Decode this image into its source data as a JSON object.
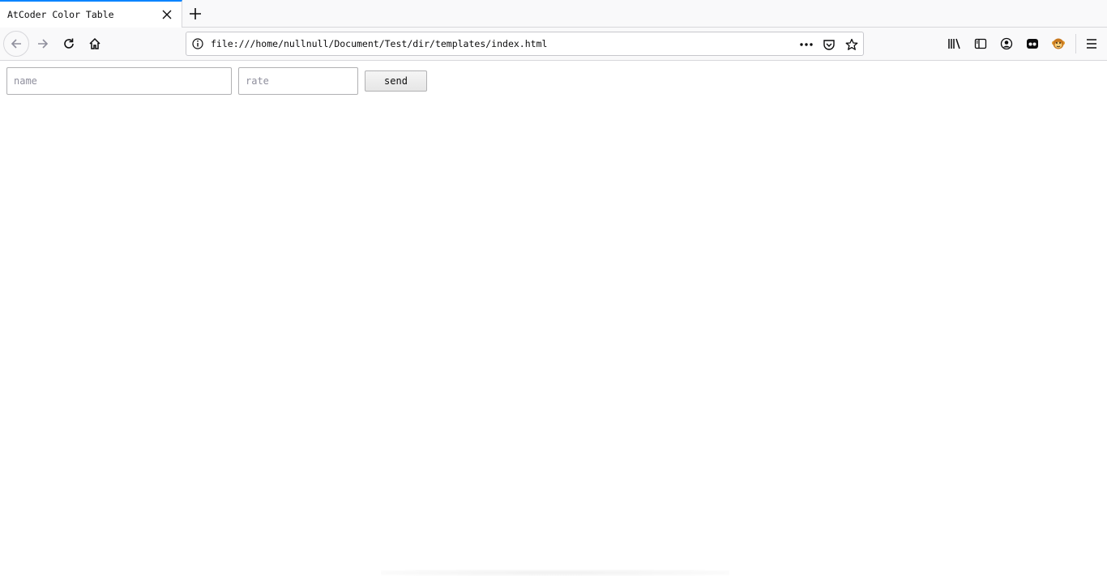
{
  "browser": {
    "tab": {
      "title": "AtCoder Color Table"
    },
    "urlbar": {
      "url": "file:///home/nullnull/Document/Test/dir/templates/index.html"
    },
    "icons": {
      "tab_close": "close-icon",
      "new_tab": "plus-icon",
      "back": "arrow-left-icon",
      "forward": "arrow-right-icon",
      "reload": "reload-icon",
      "home": "home-icon",
      "info": "info-icon",
      "more": "ellipsis-icon",
      "pocket": "pocket-icon",
      "bookmark": "star-icon",
      "library": "library-icon",
      "sidebar": "sidebar-icon",
      "account": "account-icon",
      "extension1": "extension-icon",
      "extension2": "monkey-extension-icon",
      "menu": "hamburger-menu-icon"
    },
    "accent_color": "#0a84ff"
  },
  "form": {
    "name_placeholder": "name",
    "name_value": "",
    "rate_placeholder": "rate",
    "rate_value": "",
    "send_label": "send"
  }
}
